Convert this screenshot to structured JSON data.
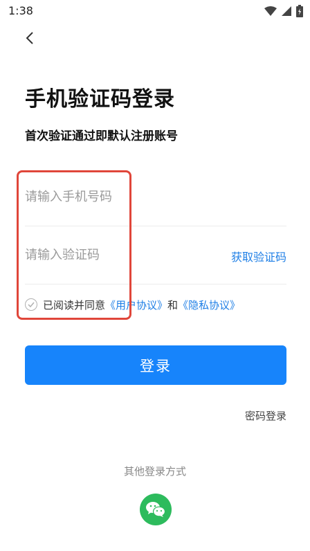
{
  "status_bar": {
    "time": "1:38",
    "icons": [
      "wifi-icon",
      "signal-icon",
      "battery-icon"
    ]
  },
  "header": {
    "back_icon": "chevron-left-icon"
  },
  "page": {
    "title": "手机验证码登录",
    "subtitle": "首次验证通过即默认注册账号"
  },
  "form": {
    "phone_placeholder": "请输入手机号码",
    "phone_value": "",
    "code_placeholder": "请输入验证码",
    "code_value": "",
    "get_code_label": "获取验证码"
  },
  "agreement": {
    "prefix": "已阅读并同意",
    "user_agreement": "《用户协议》",
    "and": "和",
    "privacy_policy": "《隐私协议》",
    "checked": false
  },
  "actions": {
    "login_label": "登录",
    "password_login_label": "密码登录"
  },
  "other_login": {
    "title": "其他登录方式",
    "wechat_icon": "wechat-icon"
  },
  "colors": {
    "primary": "#1784fb",
    "link": "#1f7fe6",
    "highlight": "#e0463a",
    "wechat": "#2dbb5d"
  }
}
